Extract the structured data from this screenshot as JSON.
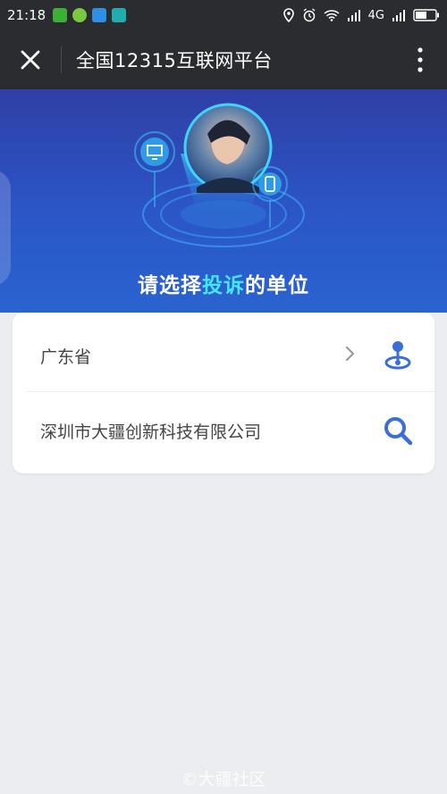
{
  "status_bar": {
    "time": "21:18",
    "network": "4G",
    "notification_icons": [
      {
        "name": "wechat-icon",
        "color": "#3cb034"
      },
      {
        "name": "green-app-icon",
        "color": "#7ac943"
      },
      {
        "name": "message-icon",
        "color": "#2e8fe6"
      },
      {
        "name": "scan-icon",
        "color": "#1faeae"
      }
    ],
    "system_icons": [
      "location-icon",
      "alarm-icon",
      "wifi-icon",
      "signal-icon",
      "signal-icon",
      "battery-icon"
    ]
  },
  "app_bar": {
    "title": "全国12315互联网平台",
    "close_icon": "close-icon",
    "more_icon": "more-vertical-icon"
  },
  "hero": {
    "title_prefix": "请选择",
    "title_highlight": "投诉",
    "title_suffix": "的单位",
    "highlight_color": "#45e6ff"
  },
  "form": {
    "province": "广东省",
    "province_icon": "location-pin-icon",
    "company": "深圳市大疆创新科技有限公司",
    "company_icon": "search-icon",
    "accent_color": "#3b6fd8"
  },
  "watermark": "©大疆社区"
}
